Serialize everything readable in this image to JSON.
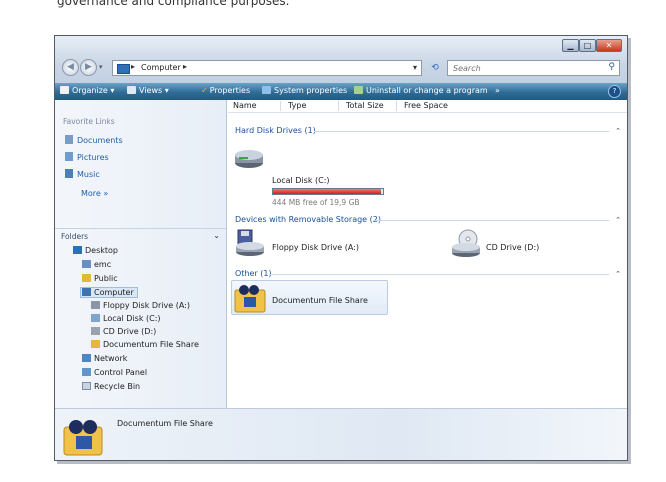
{
  "caption": "governance and compliance purposes.",
  "window": {
    "minimize_glyph": "▁",
    "maximize_glyph": "□",
    "close_glyph": "✕"
  },
  "address": {
    "path": "Computer",
    "separator": "▸",
    "search_placeholder": "Search"
  },
  "toolbar": {
    "organize": "Organize",
    "views": "Views",
    "properties": "Properties",
    "system_properties": "System properties",
    "uninstall": "Uninstall or change a program",
    "overflow": "»",
    "help": "?",
    "dropdown_glyph": "▾"
  },
  "nav": {
    "favorite_links_header": "Favorite Links",
    "favorites": [
      "Documents",
      "Pictures",
      "Music"
    ],
    "more": "More",
    "more_glyph": "»",
    "folders_header": "Folders",
    "tree": [
      "Desktop",
      "emc",
      "Public",
      "Computer",
      "Floppy Disk Drive (A:)",
      "Local Disk (C:)",
      "CD Drive (D:)",
      "Documentum File Share",
      "Network",
      "Control Panel",
      "Recycle Bin"
    ]
  },
  "columns": [
    "Name",
    "Type",
    "Total Size",
    "Free Space"
  ],
  "groups": {
    "hard_disk": "Hard Disk Drives (1)",
    "removable": "Devices with Removable Storage (2)",
    "other": "Other (1)"
  },
  "items": {
    "local_disk": "Local Disk (C:)",
    "local_disk_free": "444 MB free of 19,9 GB",
    "local_disk_used_fraction": 0.978,
    "floppy": "Floppy Disk Drive (A:)",
    "cd": "CD Drive (D:)",
    "dfs": "Documentum File Share"
  },
  "details": {
    "selected": "Documentum File Share"
  },
  "colors": {
    "toolbar": "#2e6c97",
    "usage_bar": "#d31e12",
    "link": "#1e5fae"
  }
}
